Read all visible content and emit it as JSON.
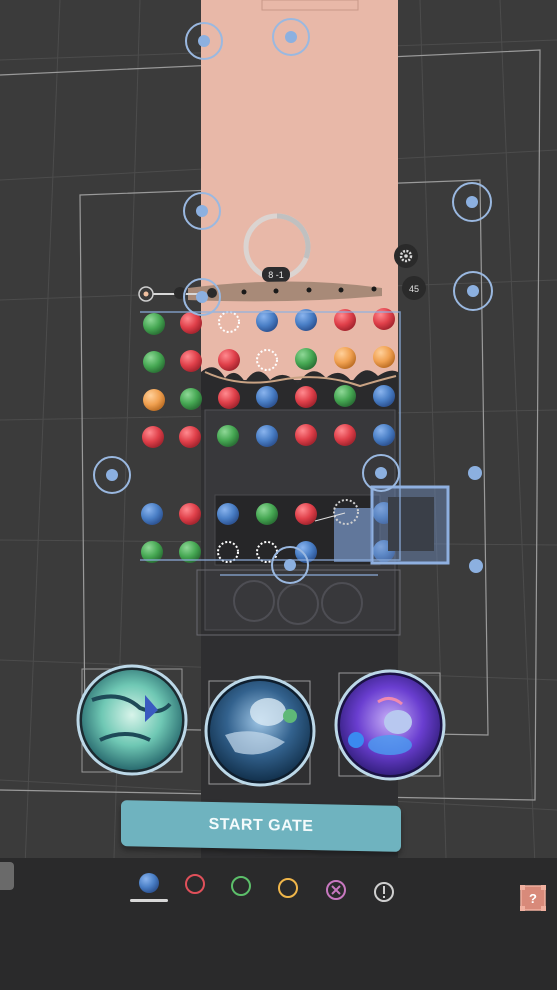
{
  "hud": {
    "step_counter": "8 -1",
    "timeline_count": "45"
  },
  "buttons": {
    "start_gate_label": "START GATE"
  },
  "characters": [
    {
      "name": "fish-spirit-portrait"
    },
    {
      "name": "whale-spirit-portrait"
    },
    {
      "name": "axolotl-spirit-portrait"
    }
  ],
  "toolbar": {
    "items": [
      {
        "icon": "blue-orb-icon",
        "selected": true
      },
      {
        "icon": "red-ring-icon",
        "color": "#e0505a"
      },
      {
        "icon": "green-ring-icon",
        "color": "#5cbf6a"
      },
      {
        "icon": "yellow-ring-icon",
        "color": "#f0b64a"
      },
      {
        "icon": "pink-x-icon",
        "color": "#c878c0"
      },
      {
        "icon": "exclamation-icon",
        "color": "#cfcfcf"
      }
    ],
    "help_icon": "question-box-icon"
  },
  "colors": {
    "red": "#e0454f",
    "green": "#4aa556",
    "blue": "#4a80c8",
    "orange": "#f0a050",
    "handle": "#9ab8e0",
    "background": "#3b3b3b",
    "column": "#e8b8a8",
    "accent": "#6fb3bf"
  }
}
